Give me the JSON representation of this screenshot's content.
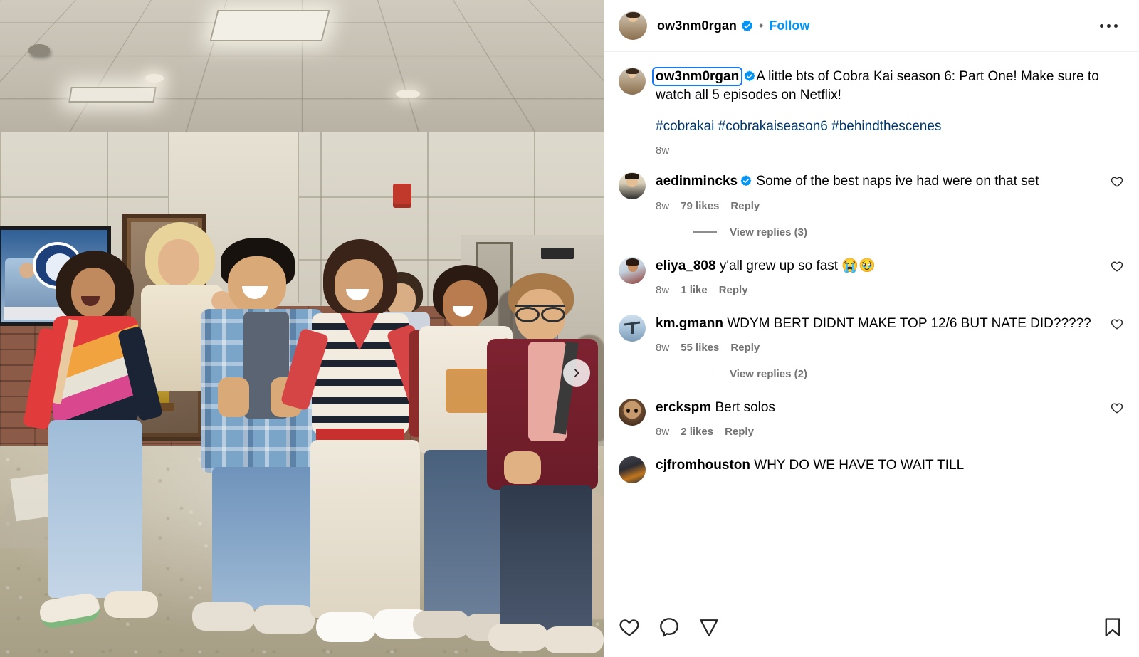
{
  "post": {
    "header": {
      "username": "ow3nm0rgan",
      "verified": true,
      "separator": "•",
      "follow_label": "Follow",
      "more_options_label": "More options",
      "avatar": "morgan-avatar"
    },
    "media": {
      "next_button_label": "Next",
      "alt": "Group of seven young actors posing together in a high school hallway"
    },
    "caption": {
      "username": "ow3nm0rgan",
      "verified": true,
      "text": "A little bts of Cobra Kai season 6: Part One! Make sure to watch all 5 episodes on Netflix!",
      "hashtags": "#cobrakai #cobrakaiseason6 #behindthescenes",
      "time": "8w"
    },
    "comments": [
      {
        "username": "aedinmincks",
        "verified": true,
        "text": "Some of the best naps ive had were on that set",
        "time": "8w",
        "likes": "79 likes",
        "reply_label": "Reply",
        "view_replies": "View replies (3)",
        "avatar": "aedin-avatar"
      },
      {
        "username": "eliya_808",
        "verified": false,
        "text": "y'all grew up so fast 😭🥹",
        "time": "8w",
        "likes": "1 like",
        "reply_label": "Reply",
        "view_replies": null,
        "avatar": "eliya-avatar"
      },
      {
        "username": "km.gmann",
        "verified": false,
        "text": "WDYM BERT DIDNT MAKE TOP 12/6 BUT NATE DID?????",
        "time": "8w",
        "likes": "55 likes",
        "reply_label": "Reply",
        "view_replies": "View replies (2)",
        "avatar": "km-avatar"
      },
      {
        "username": "erckspm",
        "verified": false,
        "text": "Bert solos",
        "time": "8w",
        "likes": "2 likes",
        "reply_label": "Reply",
        "view_replies": null,
        "avatar": "erck-avatar"
      },
      {
        "username": "cjfromhouston",
        "verified": false,
        "text": "WHY DO WE HAVE TO WAIT TILL",
        "time": null,
        "likes": null,
        "reply_label": null,
        "view_replies": null,
        "avatar": "cj-avatar"
      }
    ],
    "actions": {
      "like_label": "Like",
      "comment_label": "Comment",
      "share_label": "Share",
      "save_label": "Save"
    },
    "colors": {
      "verified_blue": "#0095f6",
      "link_blue": "#00376b",
      "follow_blue": "#0095f6",
      "focus_outline": "#1877f2",
      "muted_text": "#737373",
      "border": "#dbdbdb"
    }
  }
}
